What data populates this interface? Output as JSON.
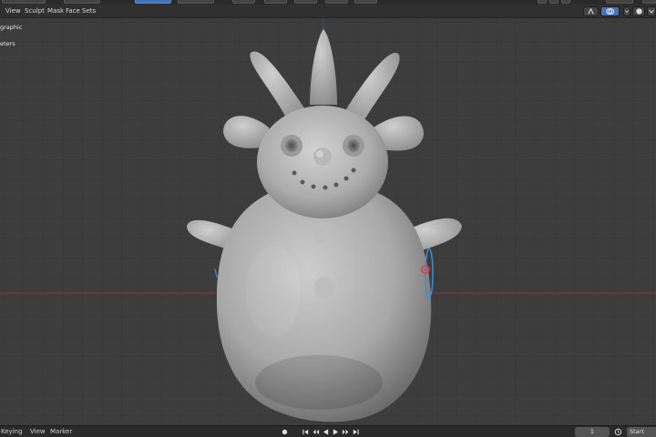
{
  "header": {
    "menus": [
      {
        "label": "View"
      },
      {
        "label": "Sculpt"
      },
      {
        "label": "Mask"
      },
      {
        "label": "Face Sets"
      }
    ]
  },
  "viewport": {
    "view_name": "graphic",
    "units_text": "eters",
    "axis_colors": {
      "x_axis": "#a03c3c",
      "z_axis": "#4a78b3"
    },
    "model": "sculpted snowman figure with spikes"
  },
  "footer": {
    "menus": [
      {
        "label": "Keying"
      },
      {
        "label": "View"
      },
      {
        "label": "Marker"
      }
    ],
    "current_frame": "1",
    "start_label": "Start"
  },
  "colors": {
    "accent": "#4772b3",
    "background": "#3d3d3d",
    "header": "#303030"
  }
}
